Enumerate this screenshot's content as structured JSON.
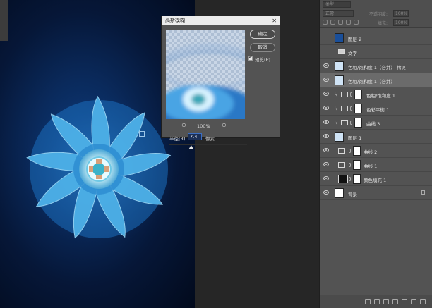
{
  "dialog": {
    "title": "高斯模糊",
    "close_glyph": "✕",
    "ok_label": "确定",
    "cancel_label": "取消",
    "preview_label": "预览(P)",
    "preview_checked": true,
    "zoom_out_glyph": "⊖",
    "zoom_in_glyph": "⊕",
    "zoom_level": "100%",
    "radius_label": "半径(R):",
    "radius_value": "7.4",
    "radius_unit": "像素",
    "radius_slider_fraction": 0.28
  },
  "layers_panel": {
    "kind_filter": "类型",
    "blend_mode": "正常",
    "opacity_label": "不透明度:",
    "opacity_value": "100%",
    "fill_label": "填充:",
    "fill_value": "100%",
    "layers": [
      {
        "name": "图层 2",
        "visible": false,
        "kind": "pixel"
      },
      {
        "name": "文字",
        "visible": false,
        "kind": "group"
      },
      {
        "name": "色相/饱和度 1（合并） 拷贝",
        "visible": true,
        "kind": "pixel"
      },
      {
        "name": "色相/饱和度 1（合并）",
        "visible": true,
        "kind": "pixel",
        "selected": true
      },
      {
        "name": "色相/饱和度 1",
        "visible": true,
        "kind": "adjustment",
        "clipped": true
      },
      {
        "name": "色彩平衡 1",
        "visible": true,
        "kind": "adjustment",
        "clipped": true
      },
      {
        "name": "曲线 3",
        "visible": true,
        "kind": "adjustment",
        "clipped": true
      },
      {
        "name": "图层 1",
        "visible": true,
        "kind": "pixel"
      },
      {
        "name": "曲线 2",
        "visible": true,
        "kind": "adjustment"
      },
      {
        "name": "曲线 1",
        "visible": true,
        "kind": "adjustment"
      },
      {
        "name": "颜色填充 1",
        "visible": true,
        "kind": "fill"
      },
      {
        "name": "背景",
        "visible": true,
        "kind": "background",
        "locked": true
      }
    ],
    "bottom_icons": [
      "link-icon",
      "fx-icon",
      "mask-icon",
      "adjustment-icon",
      "folder-icon",
      "new-layer-icon",
      "trash-icon"
    ]
  },
  "colors": {
    "canvas_bg": "#061738",
    "fan_blue": "#3aa0e0",
    "hub_cyan": "#7fe0e8",
    "panel_bg": "#535353",
    "selected_layer": "#6b6b6b"
  }
}
